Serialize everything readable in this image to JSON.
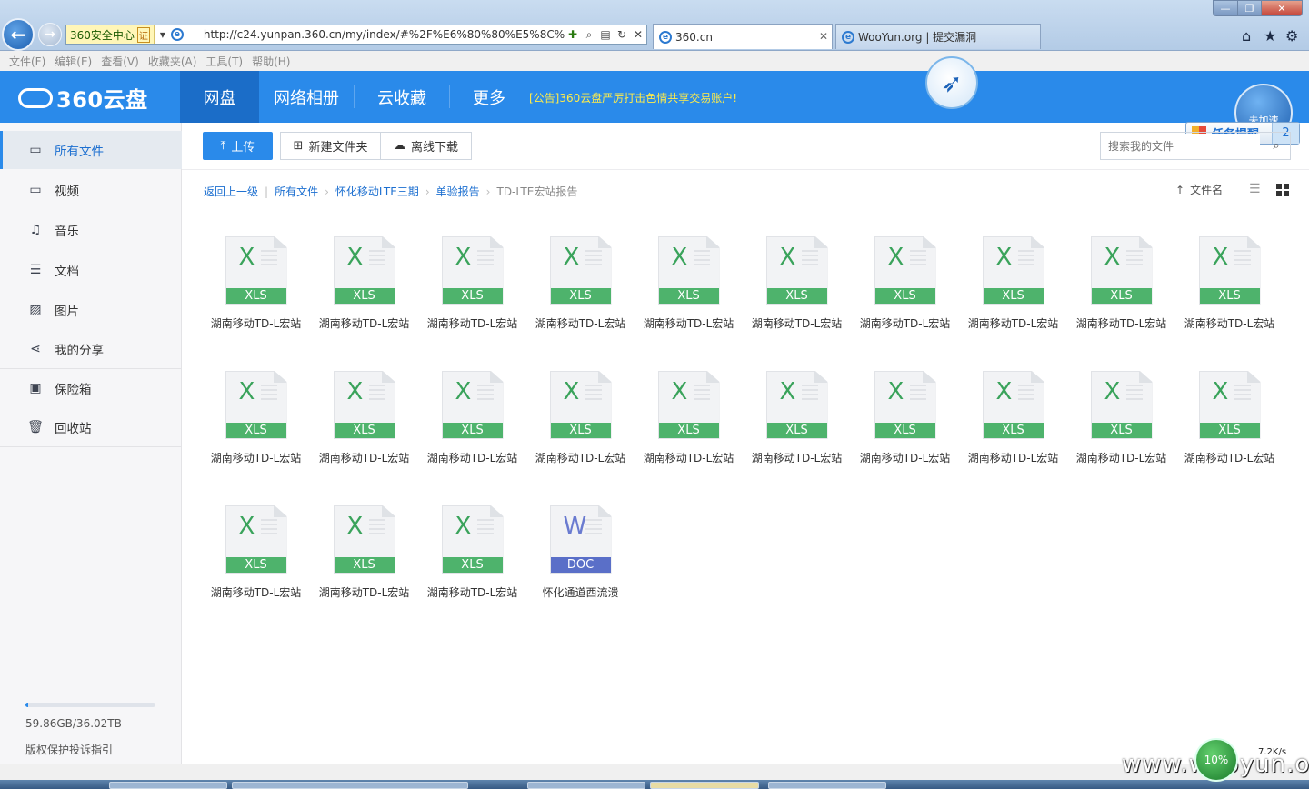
{
  "browser": {
    "security_label": "360安全中心",
    "cert_label": "证",
    "url": "http://c24.yunpan.360.cn/my/index/#%2F%E6%80%80%E5%8C%96%",
    "tabs": [
      {
        "title": "360.cn"
      },
      {
        "title": "WooYun.org | 提交漏洞"
      }
    ],
    "menu": [
      "文件(F)",
      "编辑(E)",
      "查看(V)",
      "收藏夹(A)",
      "工具(T)",
      "帮助(H)"
    ]
  },
  "header": {
    "logo": "360云盘",
    "nav": [
      {
        "label": "网盘"
      },
      {
        "label": "网络相册"
      },
      {
        "label": "云收藏"
      },
      {
        "label": "更多"
      }
    ],
    "notice": "[公告]360云盘严厉打击色情共享交易账户!",
    "speed_label": "未加速",
    "task_label": "任务提醒",
    "task_count": "2"
  },
  "sidebar": {
    "items": [
      {
        "label": "所有文件",
        "icon": "folder-icon"
      },
      {
        "label": "视频",
        "icon": "video-icon"
      },
      {
        "label": "音乐",
        "icon": "music-icon"
      },
      {
        "label": "文档",
        "icon": "document-icon"
      },
      {
        "label": "图片",
        "icon": "image-icon"
      },
      {
        "label": "我的分享",
        "icon": "share-icon"
      },
      {
        "label": "保险箱",
        "icon": "safe-icon"
      },
      {
        "label": "回收站",
        "icon": "trash-icon"
      }
    ],
    "quota": "59.86GB/36.02TB",
    "quota_fraction": 0.0017,
    "copyright": "版权保护投诉指引"
  },
  "toolbar": {
    "upload": "上传",
    "new_folder": "新建文件夹",
    "offline": "离线下载",
    "search_placeholder": "搜索我的文件"
  },
  "breadcrumb": {
    "back": "返回上一级",
    "items": [
      "所有文件",
      "怀化移动LTE三期",
      "单验报告"
    ],
    "current": "TD-LTE宏站报告"
  },
  "sort_label": "文件名",
  "files": [
    {
      "name": "湖南移动TD-L宏站",
      "type": "XLS"
    },
    {
      "name": "湖南移动TD-L宏站",
      "type": "XLS"
    },
    {
      "name": "湖南移动TD-L宏站",
      "type": "XLS"
    },
    {
      "name": "湖南移动TD-L宏站",
      "type": "XLS"
    },
    {
      "name": "湖南移动TD-L宏站",
      "type": "XLS"
    },
    {
      "name": "湖南移动TD-L宏站",
      "type": "XLS"
    },
    {
      "name": "湖南移动TD-L宏站",
      "type": "XLS"
    },
    {
      "name": "湖南移动TD-L宏站",
      "type": "XLS"
    },
    {
      "name": "湖南移动TD-L宏站",
      "type": "XLS"
    },
    {
      "name": "湖南移动TD-L宏站",
      "type": "XLS"
    },
    {
      "name": "湖南移动TD-L宏站",
      "type": "XLS"
    },
    {
      "name": "湖南移动TD-L宏站",
      "type": "XLS"
    },
    {
      "name": "湖南移动TD-L宏站",
      "type": "XLS"
    },
    {
      "name": "湖南移动TD-L宏站",
      "type": "XLS"
    },
    {
      "name": "湖南移动TD-L宏站",
      "type": "XLS"
    },
    {
      "name": "湖南移动TD-L宏站",
      "type": "XLS"
    },
    {
      "name": "湖南移动TD-L宏站",
      "type": "XLS"
    },
    {
      "name": "湖南移动TD-L宏站",
      "type": "XLS"
    },
    {
      "name": "湖南移动TD-L宏站",
      "type": "XLS"
    },
    {
      "name": "湖南移动TD-L宏站",
      "type": "XLS"
    },
    {
      "name": "湖南移动TD-L宏站",
      "type": "XLS"
    },
    {
      "name": "湖南移动TD-L宏站",
      "type": "XLS"
    },
    {
      "name": "湖南移动TD-L宏站",
      "type": "XLS"
    },
    {
      "name": "怀化通道西流溃",
      "type": "DOC"
    }
  ],
  "tray": {
    "net_percent": "10%",
    "net_speed": "7.2K/s",
    "watermark": "www.wooyun.org"
  }
}
